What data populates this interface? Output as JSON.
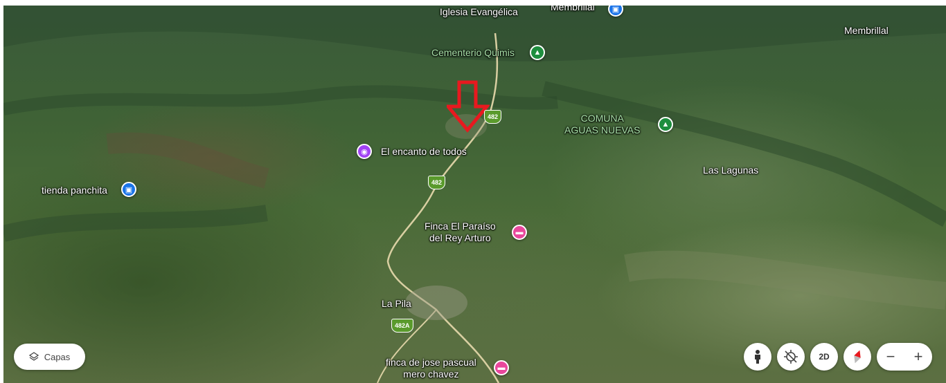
{
  "map": {
    "places": {
      "iglesia": "Iglesia Evangélica",
      "membrillal_top": "Membrillal",
      "membrillal_right": "Membrillal",
      "cementerio": "Cementerio Quimis",
      "comuna_line1": "COMUNA",
      "comuna_line2": "AGUAS NUEVAS",
      "encanto": "El encanto de todos",
      "lagunas": "Las Lagunas",
      "tienda": "tienda panchita",
      "finca_paraiso_line1": "Finca El Paraíso",
      "finca_paraiso_line2": "del Rey Arturo",
      "la_pila": "La Pila",
      "finca_jose_line1": "finca de jose pascual",
      "finca_jose_line2": "mero chavez"
    },
    "routes": {
      "route1": "482",
      "route2": "482",
      "route3": "482A"
    },
    "colors": {
      "park_pin": "#1e8e3e",
      "shopping_pin": "#1a73e8",
      "camera_pin": "#a142f4",
      "hotel_pin": "#e8479c",
      "annotation_arrow": "#e8191f"
    }
  },
  "controls": {
    "layers_label": "Capas",
    "layers_icon": "layers-icon",
    "pegman_icon": "pegman-icon",
    "location_icon": "location-off-icon",
    "view_2d_label": "2D",
    "compass_icon": "compass-icon",
    "zoom_out_label": "−",
    "zoom_in_label": "+"
  }
}
